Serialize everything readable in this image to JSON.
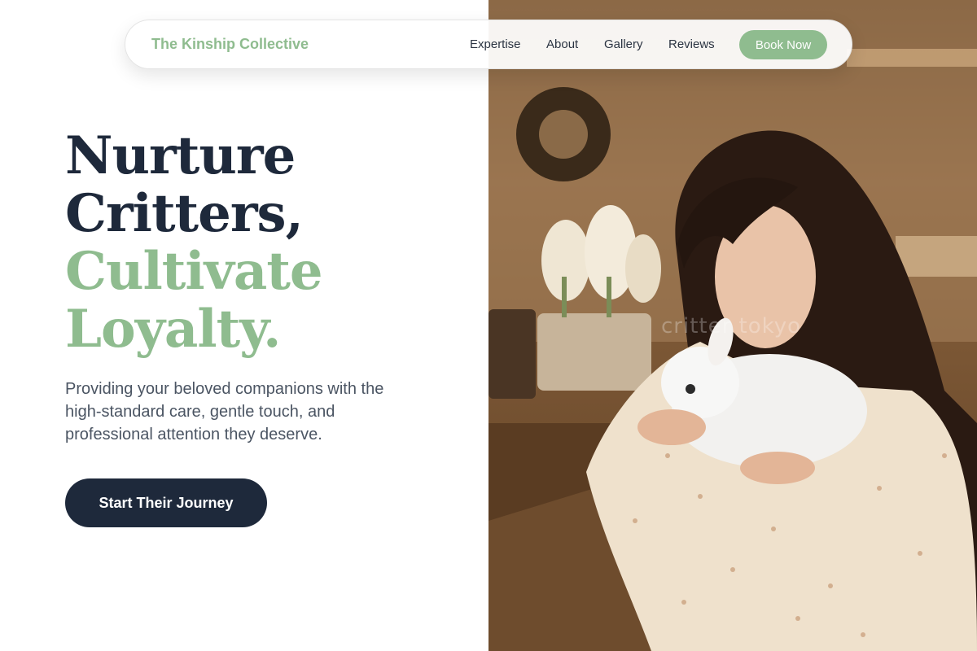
{
  "nav": {
    "brand": "The Kinship Collective",
    "links": [
      "Expertise",
      "About",
      "Gallery",
      "Reviews"
    ],
    "cta": "Book Now"
  },
  "hero": {
    "headline_lines": [
      "Nurture",
      "Critters,",
      "Cultivate",
      "Loyalty."
    ],
    "subtitle": "Providing your beloved companions with the high-standard care, gentle touch, and professional attention they deserve.",
    "cta": "Start Their Journey",
    "image_watermark": "critter tokyo"
  },
  "colors": {
    "brand_green": "#8fbc8f",
    "navy": "#1e293b",
    "body_text": "#4b5563"
  }
}
